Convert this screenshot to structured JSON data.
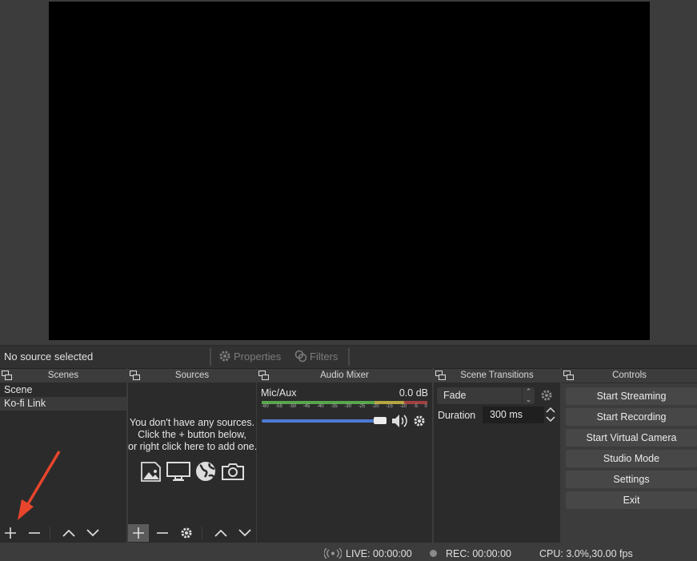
{
  "source_bar": {
    "no_source": "No source selected",
    "properties": "Properties",
    "filters": "Filters"
  },
  "scenes": {
    "title": "Scenes",
    "items": [
      {
        "label": "Scene"
      },
      {
        "label": "Ko-fi Link"
      }
    ]
  },
  "sources": {
    "title": "Sources",
    "empty_line1": "You don't have any sources.",
    "empty_line2": "Click the + button below,",
    "empty_line3": "or right click here to add one."
  },
  "mixer": {
    "title": "Audio Mixer",
    "channel_name": "Mic/Aux",
    "channel_db": "0.0 dB",
    "ticks": [
      "-60",
      "-55",
      "-50",
      "-45",
      "-40",
      "-35",
      "-30",
      "-25",
      "-20",
      "-15",
      "-10",
      "-5",
      "0"
    ],
    "volume_level": 1.0
  },
  "transitions": {
    "title": "Scene Transitions",
    "selected": "Fade",
    "duration_label": "Duration",
    "duration_value": "300 ms"
  },
  "controls": {
    "title": "Controls",
    "buttons": [
      "Start Streaming",
      "Start Recording",
      "Start Virtual Camera",
      "Studio Mode",
      "Settings",
      "Exit"
    ]
  },
  "status": {
    "live": "LIVE: 00:00:00",
    "rec": "REC: 00:00:00",
    "cpu": "CPU: 3.0%,30.00 fps"
  },
  "colors": {
    "annotation_arrow": "#e8452c",
    "slider": "#4e7ad4"
  }
}
